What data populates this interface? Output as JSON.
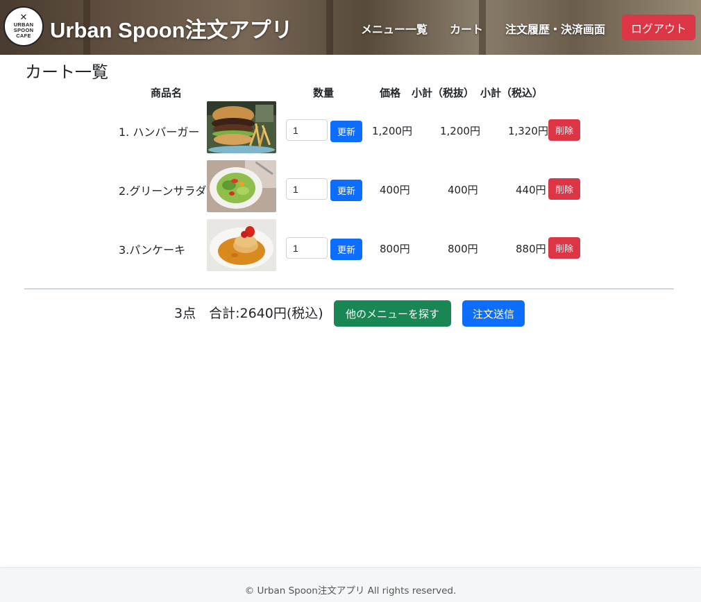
{
  "header": {
    "logo_lines": [
      "URBAN",
      "SPOON",
      "CAFE"
    ],
    "brand": "Urban Spoon注文アプリ",
    "nav": {
      "menu": "メニュー一覧",
      "cart": "カート",
      "history": "注文履歴・決済画面",
      "logout": "ログアウト"
    }
  },
  "page": {
    "title": "カート一覧"
  },
  "columns": {
    "product": "商品名",
    "quantity": "数量",
    "price": "価格",
    "subtotal_ex": "小計（税抜）",
    "subtotal_in": "小計（税込）"
  },
  "items": [
    {
      "name": "1. ハンバーガー",
      "image": "hamburger-photo",
      "quantity": "1",
      "update": "更新",
      "price": "1,200円",
      "subtotal_ex": "1,200円",
      "subtotal_in": "1,320円",
      "delete": "削除"
    },
    {
      "name": "2.グリーンサラダ",
      "image": "green-salad-photo",
      "quantity": "1",
      "update": "更新",
      "price": "400円",
      "subtotal_ex": "400円",
      "subtotal_in": "440円",
      "delete": "削除"
    },
    {
      "name": "3.パンケーキ",
      "image": "pancake-photo",
      "quantity": "1",
      "update": "更新",
      "price": "800円",
      "subtotal_ex": "800円",
      "subtotal_in": "880円",
      "delete": "削除"
    }
  ],
  "summary": {
    "text": "3点　合計:2640円(税込)",
    "browse_button": "他のメニューを探す",
    "submit_button": "注文送信"
  },
  "colors": {
    "primary": "#0d6efd",
    "danger": "#dc3545",
    "success": "#198754"
  },
  "footer": {
    "text": "© Urban Spoon注文アプリ All rights reserved."
  }
}
